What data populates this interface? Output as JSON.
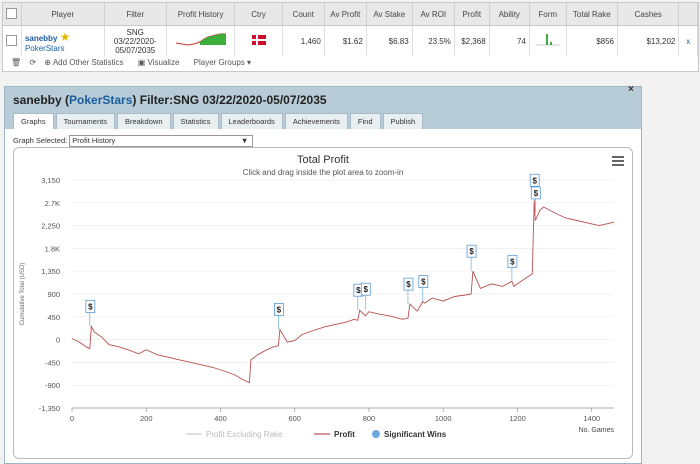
{
  "table": {
    "headers": [
      "Player",
      "Filter",
      "Profit History",
      "Ctry",
      "Count",
      "Av Profit",
      "Av Stake",
      "Av ROI",
      "Profit",
      "Ability",
      "Form",
      "Total Rake",
      "Cashes"
    ],
    "row": {
      "player_name": "sanebby",
      "player_site": "PokerStars",
      "filter_line1": "SNG",
      "filter_line2": "03/22/2020-",
      "filter_line3": "05/07/2035",
      "count": "1,460",
      "av_profit": "$1.62",
      "av_stake": "$6.83",
      "av_roi": "23.5%",
      "profit": "$2,368",
      "ability": "74",
      "total_rake": "$856",
      "cashes": "$13,202",
      "link_icon": "x"
    },
    "toolbar": {
      "add_stats": "Add Other Statistics",
      "visualize": "Visualize",
      "player_groups": "Player Groups ▾"
    }
  },
  "panel": {
    "title_player": "sanebby",
    "title_site": "PokerStars",
    "title_filter": "Filter:SNG 03/22/2020-05/07/2035",
    "tabs": [
      "Graphs",
      "Tournaments",
      "Breakdown",
      "Statistics",
      "Leaderboards",
      "Achievements",
      "Find",
      "Publish"
    ],
    "graph_selected_label": "Graph Selected:",
    "graph_selected_value": "Profit History",
    "close": "×"
  },
  "chart_data": {
    "type": "line",
    "title": "Total Profit",
    "subtitle": "Click and drag inside the plot area to zoom-in",
    "ylabel": "Cumulative Total (USD)",
    "xlabel": "No. Games",
    "xlim": [
      0,
      1460
    ],
    "ylim": [
      -1350,
      3150
    ],
    "x_ticks": [
      0,
      200,
      400,
      600,
      800,
      1000,
      1200,
      1400
    ],
    "y_ticks": [
      3150,
      2700,
      2250,
      1800,
      1350,
      900,
      450,
      0,
      -450,
      -900,
      -1350
    ],
    "y_tick_labels": [
      "3,150",
      "2.7K",
      "2,250",
      "1.8K",
      "1,350",
      "900",
      "450",
      "0",
      "-450",
      "-900",
      "-1,350"
    ],
    "legend": [
      "Profit Excluding Rake",
      "Profit",
      "Significant Wins"
    ],
    "series": [
      {
        "name": "Profit",
        "x": [
          0,
          20,
          40,
          48,
          52,
          60,
          80,
          100,
          120,
          150,
          180,
          200,
          230,
          260,
          290,
          320,
          350,
          380,
          410,
          440,
          460,
          478,
          482,
          500,
          520,
          540,
          556,
          560,
          580,
          600,
          620,
          650,
          680,
          710,
          740,
          760,
          770,
          775,
          790,
          800,
          830,
          860,
          890,
          905,
          910,
          930,
          945,
          950,
          970,
          1000,
          1030,
          1060,
          1075,
          1080,
          1100,
          1130,
          1160,
          1185,
          1190,
          1210,
          1240,
          1245,
          1248,
          1260,
          1270,
          1300,
          1330,
          1360,
          1390,
          1420,
          1450,
          1460
        ],
        "y": [
          20,
          -50,
          -150,
          -180,
          260,
          150,
          50,
          -100,
          -130,
          -200,
          -280,
          -200,
          -300,
          -350,
          -400,
          -450,
          -500,
          -550,
          -620,
          -700,
          -790,
          -850,
          -400,
          -300,
          -220,
          -150,
          -120,
          200,
          -50,
          -20,
          100,
          180,
          250,
          300,
          350,
          400,
          380,
          580,
          470,
          550,
          500,
          460,
          400,
          420,
          700,
          560,
          750,
          720,
          820,
          760,
          850,
          880,
          900,
          1350,
          1010,
          1100,
          1050,
          1150,
          1050,
          1150,
          1300,
          2750,
          2350,
          2550,
          2620,
          2500,
          2400,
          2350,
          2300,
          2250,
          2300,
          2320
        ]
      },
      {
        "name": "Significant Wins",
        "x": [
          48,
          556,
          770,
          790,
          905,
          945,
          1075,
          1185,
          1245,
          1248
        ],
        "y": [
          260,
          200,
          580,
          600,
          700,
          750,
          1350,
          1150,
          2750,
          2500
        ]
      }
    ]
  }
}
